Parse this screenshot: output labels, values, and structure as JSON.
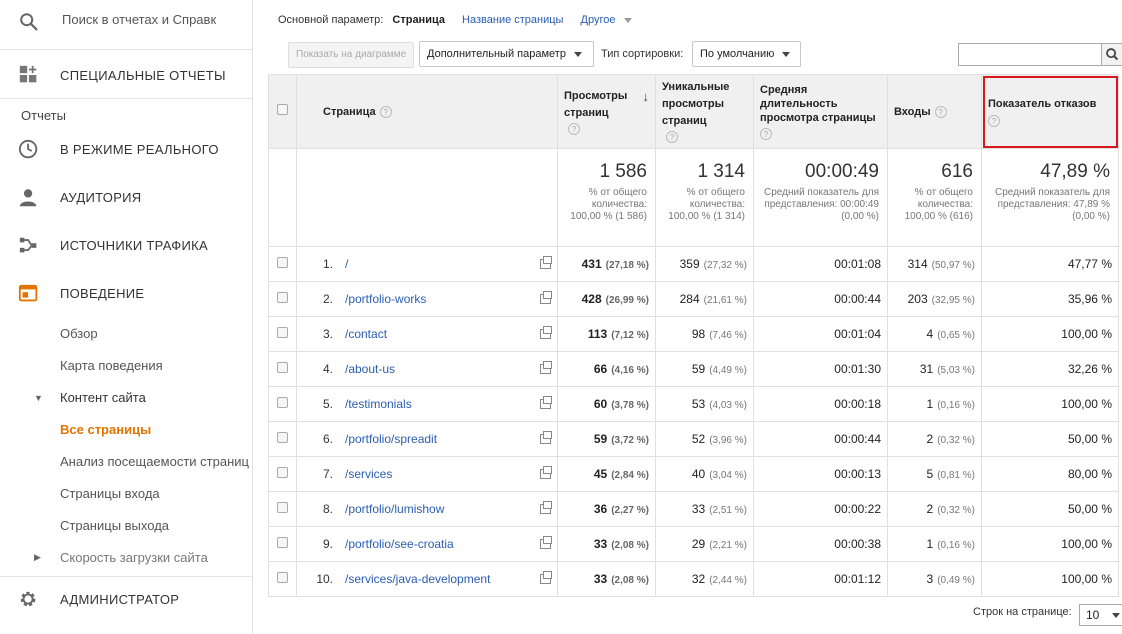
{
  "sidebar": {
    "search_placeholder": "Поиск в отчетах и Справк",
    "special_reports": "СПЕЦИАЛЬНЫЕ ОТЧЕТЫ",
    "reports_label": "Отчеты",
    "realtime": "В РЕЖИМЕ РЕАЛЬНОГО",
    "audience": "АУДИТОРИЯ",
    "traffic": "ИСТОЧНИКИ ТРАФИКА",
    "behavior": "ПОВЕДЕНИЕ",
    "behavior_items": {
      "overview": "Обзор",
      "behavior_flow": "Карта поведения",
      "site_content": "Контент сайта",
      "all_pages": "Все страницы",
      "content_drilldown": "Анализ посещаемости страниц",
      "landing_pages": "Страницы входа",
      "exit_pages": "Страницы выхода",
      "site_speed": "Скорость загрузки сайта"
    },
    "admin": "АДМИНИСТРАТОР",
    "accent_color": "#e37400"
  },
  "toolbar": {
    "primary_dimension_label": "Основной параметр:",
    "primary_dimension_current": "Страница",
    "dimension_page_title": "Название страницы",
    "dimension_other": "Другое",
    "plot_rows": "Показать на диаграмме",
    "secondary_dimension": "Дополнительный параметр",
    "sort_type_label": "Тип сортировки:",
    "sort_type_value": "По умолчанию",
    "search_value": ""
  },
  "table": {
    "headers": {
      "page": "Страница",
      "pageviews": "Просмотры страниц",
      "unique_pageviews": "Уникальные просмотры страниц",
      "avg_time": "Средняя длительность просмотра страницы",
      "entrances": "Входы",
      "bounce_rate": "Показатель отказов",
      "help": "?"
    },
    "totals": {
      "pageviews": "1 586",
      "pageviews_note": "% от общего количества: 100,00 % (1 586)",
      "unique": "1 314",
      "unique_note": "% от общего количества: 100,00 % (1 314)",
      "avg_time": "00:00:49",
      "avg_time_note": "Средний показатель для представления: 00:00:49 (0,00 %)",
      "entrances": "616",
      "entrances_note": "% от общего количества: 100,00 % (616)",
      "bounce": "47,89 %",
      "bounce_note": "Средний показатель для представления: 47,89 % (0,00 %)"
    },
    "rows": [
      {
        "n": "1.",
        "page": "/",
        "pv": "431",
        "pv_pct": "(27,18 %)",
        "uv": "359",
        "uv_pct": "(27,32 %)",
        "time": "00:01:08",
        "ent": "314",
        "ent_pct": "(50,97 %)",
        "bounce": "47,77 %"
      },
      {
        "n": "2.",
        "page": "/portfolio-works",
        "pv": "428",
        "pv_pct": "(26,99 %)",
        "uv": "284",
        "uv_pct": "(21,61 %)",
        "time": "00:00:44",
        "ent": "203",
        "ent_pct": "(32,95 %)",
        "bounce": "35,96 %"
      },
      {
        "n": "3.",
        "page": "/contact",
        "pv": "113",
        "pv_pct": "(7,12 %)",
        "uv": "98",
        "uv_pct": "(7,46 %)",
        "time": "00:01:04",
        "ent": "4",
        "ent_pct": "(0,65 %)",
        "bounce": "100,00 %"
      },
      {
        "n": "4.",
        "page": "/about-us",
        "pv": "66",
        "pv_pct": "(4,16 %)",
        "uv": "59",
        "uv_pct": "(4,49 %)",
        "time": "00:01:30",
        "ent": "31",
        "ent_pct": "(5,03 %)",
        "bounce": "32,26 %"
      },
      {
        "n": "5.",
        "page": "/testimonials",
        "pv": "60",
        "pv_pct": "(3,78 %)",
        "uv": "53",
        "uv_pct": "(4,03 %)",
        "time": "00:00:18",
        "ent": "1",
        "ent_pct": "(0,16 %)",
        "bounce": "100,00 %"
      },
      {
        "n": "6.",
        "page": "/portfolio/spreadit",
        "pv": "59",
        "pv_pct": "(3,72 %)",
        "uv": "52",
        "uv_pct": "(3,96 %)",
        "time": "00:00:44",
        "ent": "2",
        "ent_pct": "(0,32 %)",
        "bounce": "50,00 %"
      },
      {
        "n": "7.",
        "page": "/services",
        "pv": "45",
        "pv_pct": "(2,84 %)",
        "uv": "40",
        "uv_pct": "(3,04 %)",
        "time": "00:00:13",
        "ent": "5",
        "ent_pct": "(0,81 %)",
        "bounce": "80,00 %"
      },
      {
        "n": "8.",
        "page": "/portfolio/lumishow",
        "pv": "36",
        "pv_pct": "(2,27 %)",
        "uv": "33",
        "uv_pct": "(2,51 %)",
        "time": "00:00:22",
        "ent": "2",
        "ent_pct": "(0,32 %)",
        "bounce": "50,00 %"
      },
      {
        "n": "9.",
        "page": "/portfolio/see-croatia",
        "pv": "33",
        "pv_pct": "(2,08 %)",
        "uv": "29",
        "uv_pct": "(2,21 %)",
        "time": "00:00:38",
        "ent": "1",
        "ent_pct": "(0,16 %)",
        "bounce": "100,00 %"
      },
      {
        "n": "10.",
        "page": "/services/java-development",
        "pv": "33",
        "pv_pct": "(2,08 %)",
        "uv": "32",
        "uv_pct": "(2,44 %)",
        "time": "00:01:12",
        "ent": "3",
        "ent_pct": "(0,49 %)",
        "bounce": "100,00 %"
      }
    ]
  },
  "footer": {
    "rows_per_page_label": "Строк на странице:",
    "rows_per_page_value": "10"
  },
  "colors": {
    "link": "#2a5db0",
    "highlight_border": "#d9181b"
  }
}
